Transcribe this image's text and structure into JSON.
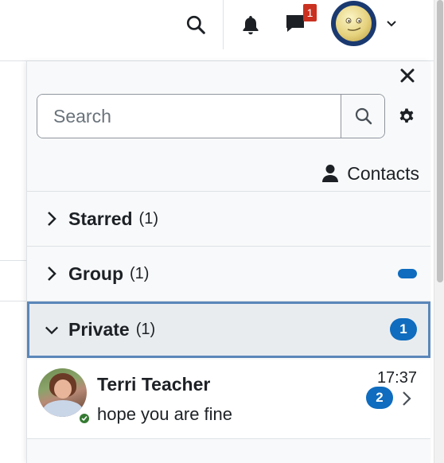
{
  "navbar": {
    "search_icon": "search-icon",
    "notifications_icon": "bell-icon",
    "messages_icon": "comment-icon",
    "messages_badge": "1",
    "avatar_icon": "user-avatar",
    "menu_icon": "chevron-down-icon"
  },
  "drawer": {
    "close_icon": "close-icon",
    "search": {
      "placeholder": "Search",
      "value": ""
    },
    "settings_icon": "gear-icon",
    "contacts_label": "Contacts",
    "sections": [
      {
        "title": "Starred",
        "count": "(1)",
        "expanded": false
      },
      {
        "title": "Group",
        "count": "(1)",
        "expanded": false,
        "indicator": "pill"
      },
      {
        "title": "Private",
        "count": "(1)",
        "expanded": true,
        "unread": "1"
      }
    ],
    "conversations": [
      {
        "name": "Terri Teacher",
        "last_message": "hope you are fine",
        "time": "17:37",
        "unread": "2",
        "online": true
      }
    ]
  },
  "colors": {
    "accent": "#0f6cbf",
    "badge_red": "#ca3120",
    "online_green": "#357a32",
    "active_border": "#5a87b9"
  }
}
